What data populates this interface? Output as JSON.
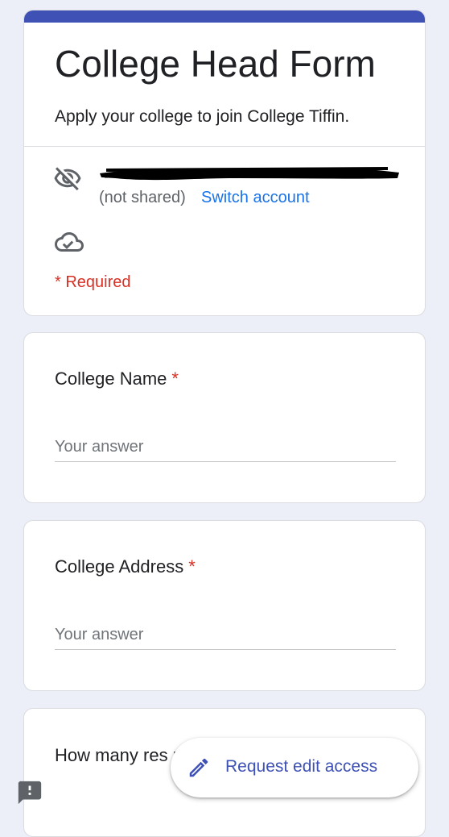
{
  "form": {
    "title": "College Head Form",
    "description": "Apply your college to join College Tiffin.",
    "accent_color": "#3f51b5"
  },
  "account": {
    "not_shared": "(not shared)",
    "switch_account": "Switch account",
    "hidden_icon": "eye-off-icon",
    "cloud_icon": "cloud-check-icon"
  },
  "required_note": "* Required",
  "questions": [
    {
      "title": "College Name",
      "required_mark": "*",
      "placeholder": "Your answer"
    },
    {
      "title": "College Address",
      "required_mark": "*",
      "placeholder": "Your answer"
    },
    {
      "title": "How many res nearby your co"
    }
  ],
  "fab": {
    "label": "Request edit access",
    "icon": "pencil-icon"
  },
  "feedback_icon": "report-feedback-icon"
}
